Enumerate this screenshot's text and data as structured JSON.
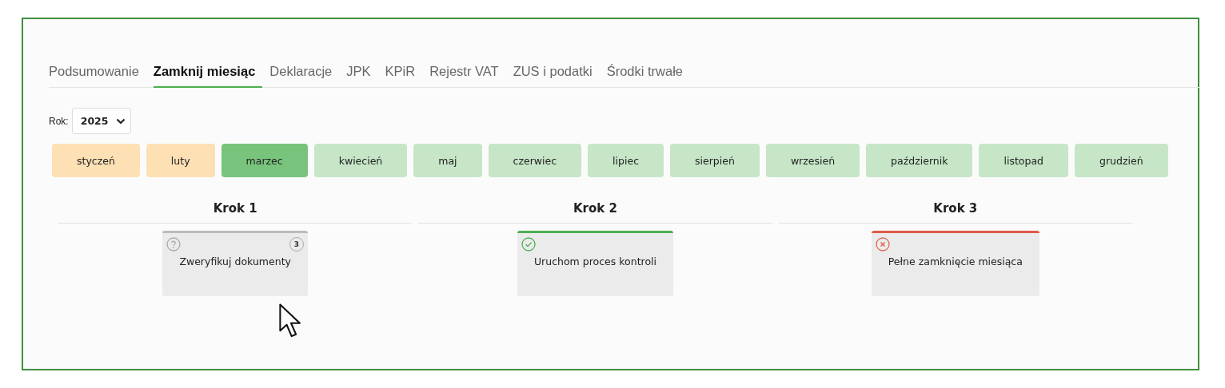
{
  "tabs": [
    {
      "label": "Podsumowanie",
      "selected": false
    },
    {
      "label": "Zamknij miesiąc",
      "selected": true
    },
    {
      "label": "Deklaracje",
      "selected": false
    },
    {
      "label": "JPK",
      "selected": false
    },
    {
      "label": "KPiR",
      "selected": false
    },
    {
      "label": "Rejestr VAT",
      "selected": false
    },
    {
      "label": "ZUS i podatki",
      "selected": false
    },
    {
      "label": "Środki trwałe",
      "selected": false
    }
  ],
  "year": {
    "label": "Rok:",
    "value": "2025"
  },
  "months": [
    {
      "label": "styczeń",
      "kind": "closed",
      "selected": false
    },
    {
      "label": "luty",
      "kind": "closed",
      "selected": false
    },
    {
      "label": "marzec",
      "kind": "open",
      "selected": true
    },
    {
      "label": "kwiecień",
      "kind": "open",
      "selected": false
    },
    {
      "label": "maj",
      "kind": "open",
      "selected": false
    },
    {
      "label": "czerwiec",
      "kind": "open",
      "selected": false
    },
    {
      "label": "lipiec",
      "kind": "open",
      "selected": false
    },
    {
      "label": "sierpień",
      "kind": "open",
      "selected": false
    },
    {
      "label": "wrzesień",
      "kind": "open",
      "selected": false
    },
    {
      "label": "październik",
      "kind": "open",
      "selected": false
    },
    {
      "label": "listopad",
      "kind": "open",
      "selected": false
    },
    {
      "label": "grudzień",
      "kind": "open",
      "selected": false
    }
  ],
  "steps": [
    {
      "title": "Krok 1",
      "card": {
        "label": "Zweryfikuj dokumenty",
        "kind": "pending",
        "count": "3"
      }
    },
    {
      "title": "Krok 2",
      "card": {
        "label": "Uruchom proces kontroli",
        "kind": "done"
      }
    },
    {
      "title": "Krok 3",
      "card": {
        "label": "Pełne zamknięcie miesiąca",
        "kind": "error"
      }
    }
  ]
}
